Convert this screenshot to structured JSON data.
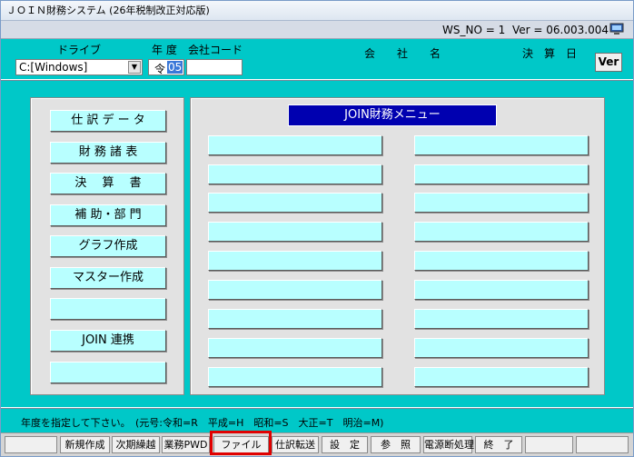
{
  "window": {
    "title": "ＪＯＩＮ財務システム (26年税制改正対応版)"
  },
  "info": {
    "ws_no": "WS_NO = 1",
    "version": "Ver = 06.003.004"
  },
  "header": {
    "drive_label": "ドライブ",
    "drive_value": "C:[Windows]",
    "year_label": "年 度",
    "code_label": "会社コード",
    "era": "令",
    "year_value": "05",
    "company_name_label": "会　　社　　名",
    "closing_label": "決　算　日",
    "ver_button": "Ver"
  },
  "left_menu": [
    "仕 訳 デ ー タ",
    "財 務 諸 表",
    "決　 算 　書",
    "補 助・部 門",
    "グラフ作成",
    "マスター作成",
    "",
    "JOIN 連携",
    ""
  ],
  "menu_title": "JOIN財務メニュー",
  "status": {
    "message": "年度を指定して下さい。",
    "hint": "(元号:令和=R　平成=H　昭和=S　大正=T　明治=M)"
  },
  "fkeys": [
    "",
    "新規作成",
    "次期繰越",
    "業務PWD",
    "ファイル",
    "仕訳転送",
    "設　定",
    "参　照",
    "電源断処理",
    "終　了",
    "",
    ""
  ]
}
